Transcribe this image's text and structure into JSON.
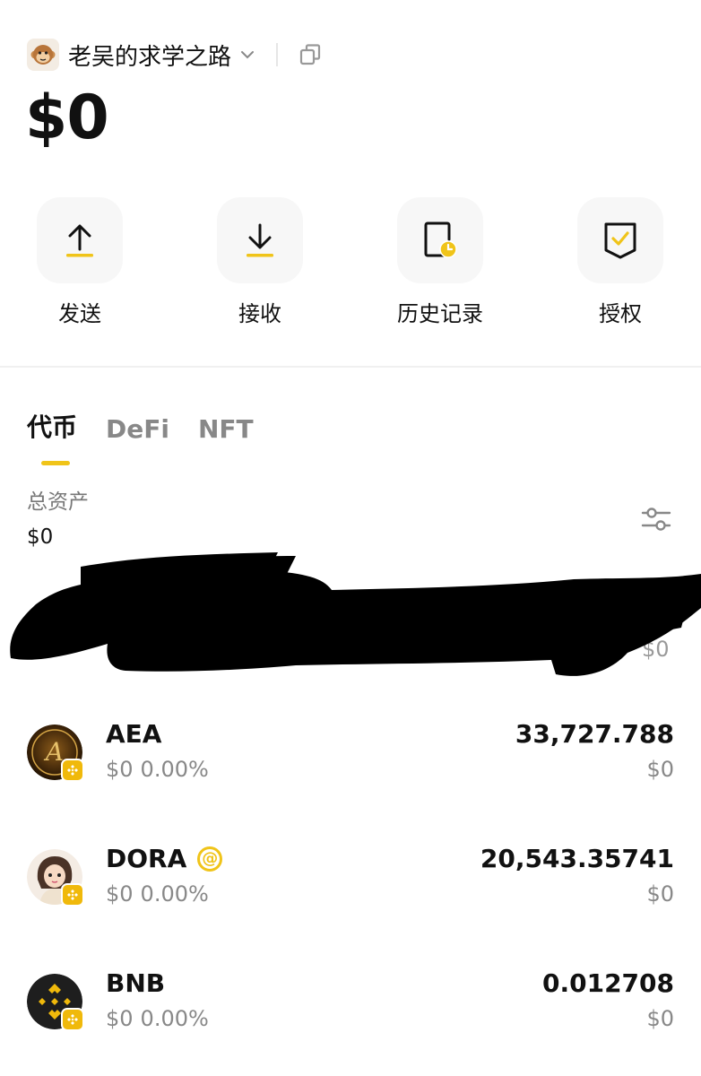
{
  "header": {
    "wallet_name": "老吴的求学之路",
    "avatar_icon": "monkey-avatar-icon",
    "dropdown_icon": "chevron-down-icon",
    "copy_icon": "copy-icon"
  },
  "balance": "$0",
  "actions": [
    {
      "label": "发送",
      "icon": "send-arrow-up-icon"
    },
    {
      "label": "接收",
      "icon": "receive-arrow-down-icon"
    },
    {
      "label": "历史记录",
      "icon": "history-clock-icon"
    },
    {
      "label": "授权",
      "icon": "authorize-shield-check-icon"
    }
  ],
  "tabs": [
    "代币",
    "DeFi",
    "NFT"
  ],
  "active_tab": "代币",
  "assets": {
    "total_label": "总资产",
    "total_value": "$0",
    "filter_icon": "filter-sliders-icon",
    "redacted_row_fiat": "$0"
  },
  "tokens": [
    {
      "symbol": "AEA",
      "fiat": "$0",
      "change": "0.00%",
      "amount": "33,727.788",
      "value": "$0",
      "logo": "aea-logo-icon",
      "chain_badge": "bnb-chain-badge-icon"
    },
    {
      "symbol": "DORA",
      "fiat": "$0",
      "change": "0.00%",
      "amount": "20,543.35741",
      "value": "$0",
      "logo": "dora-avatar-icon",
      "chain_badge": "bnb-chain-badge-icon",
      "tag": "@"
    },
    {
      "symbol": "BNB",
      "fiat": "$0",
      "change": "0.00%",
      "amount": "0.012708",
      "value": "$0",
      "logo": "bnb-logo-icon",
      "chain_badge": "bnb-chain-badge-icon"
    }
  ],
  "colors": {
    "accent": "#f0c419",
    "bnb": "#f0b90b",
    "text": "#111111",
    "muted": "#888888"
  }
}
